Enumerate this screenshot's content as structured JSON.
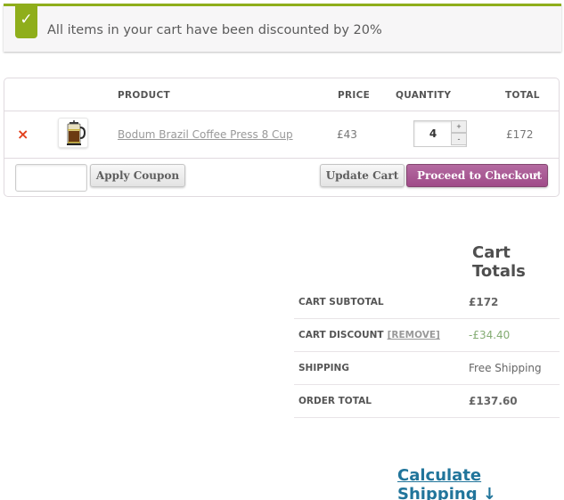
{
  "notice": {
    "icon": "check-icon",
    "message": "All items in your cart have been discounted by 20%",
    "accent_color": "#8fae1b"
  },
  "cart": {
    "headers": {
      "product": "PRODUCT",
      "price": "PRICE",
      "quantity": "QUANTITY",
      "total": "TOTAL"
    },
    "items": [
      {
        "remove": "×",
        "thumbnail": "coffee-press-image",
        "name": "Bodum Brazil Coffee Press 8 Cup",
        "price": "£43",
        "quantity": "4",
        "total": "£172"
      }
    ],
    "qty_plus": "+",
    "qty_minus": "-",
    "coupon_placeholder": "",
    "apply_coupon": "Apply Coupon",
    "update_cart": "Update Cart",
    "proceed_checkout": "Proceed to Checkout",
    "proceed_arrow": "›",
    "checkout_color": "#a46497"
  },
  "totals": {
    "title": "Cart Totals",
    "rows": [
      {
        "label": "CART SUBTOTAL",
        "value": "£172"
      },
      {
        "label": "CART DISCOUNT",
        "remove_link": "[REMOVE]",
        "value": "-£34.40"
      },
      {
        "label": "SHIPPING",
        "value": "Free Shipping"
      },
      {
        "label": "ORDER TOTAL",
        "value": "£137.60"
      }
    ]
  },
  "calculate_shipping": "Calculate Shipping ↓"
}
